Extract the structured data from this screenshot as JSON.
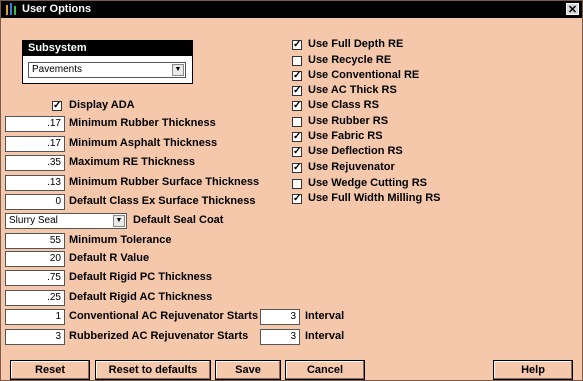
{
  "window": {
    "title": "User Options",
    "close_glyph": "✕"
  },
  "subsystem": {
    "label": "Subsystem",
    "selected": "Pavements"
  },
  "display_ada": {
    "label": "Display ADA",
    "checked": true
  },
  "fields": [
    {
      "value": ".17",
      "label": "Minimum Rubber Thickness"
    },
    {
      "value": ".17",
      "label": "Minimum Asphalt Thickness"
    },
    {
      "value": ".35",
      "label": "Maximum RE Thickness"
    },
    {
      "value": ".13",
      "label": "Minimum Rubber Surface Thickness"
    },
    {
      "value": "0",
      "label": "Default Class Ex Surface Thickness"
    }
  ],
  "seal_coat": {
    "selected": "Slurry Seal",
    "label": "Default Seal Coat"
  },
  "fields2": [
    {
      "value": "55",
      "label": "Minimum Tolerance"
    },
    {
      "value": "20",
      "label": "Default R Value"
    },
    {
      "value": ".75",
      "label": "Default Rigid PC Thickness"
    },
    {
      "value": ".25",
      "label": "Default Rigid AC Thickness"
    }
  ],
  "rejuvenator": [
    {
      "value": "1",
      "label": "Conventional AC Rejuvenator Starts",
      "interval_value": "3",
      "interval_label": "Interval"
    },
    {
      "value": "3",
      "label": "Rubberized AC Rejuvenator Starts",
      "interval_value": "3",
      "interval_label": "Interval"
    }
  ],
  "options": [
    {
      "label": "Use Full Depth RE",
      "checked": true
    },
    {
      "label": "Use Recycle RE",
      "checked": false
    },
    {
      "label": "Use Conventional RE",
      "checked": true
    },
    {
      "label": "Use AC Thick RS",
      "checked": true
    },
    {
      "label": "Use Class RS",
      "checked": true
    },
    {
      "label": "Use Rubber RS",
      "checked": false
    },
    {
      "label": "Use Fabric RS",
      "checked": true
    },
    {
      "label": "Use Deflection RS",
      "checked": true
    },
    {
      "label": "Use Rejuvenator",
      "checked": true
    },
    {
      "label": "Use Wedge Cutting RS",
      "checked": false
    },
    {
      "label": "Use Full Width Milling RS",
      "checked": true
    }
  ],
  "buttons": {
    "reset": "Reset",
    "reset_defaults": "Reset to defaults",
    "save": "Save",
    "cancel": "Cancel",
    "help": "Help"
  },
  "glyphs": {
    "check": "✓",
    "dropdown": "▼"
  },
  "colors": {
    "background": "#f5c8ac",
    "title_bar": "#000000"
  }
}
